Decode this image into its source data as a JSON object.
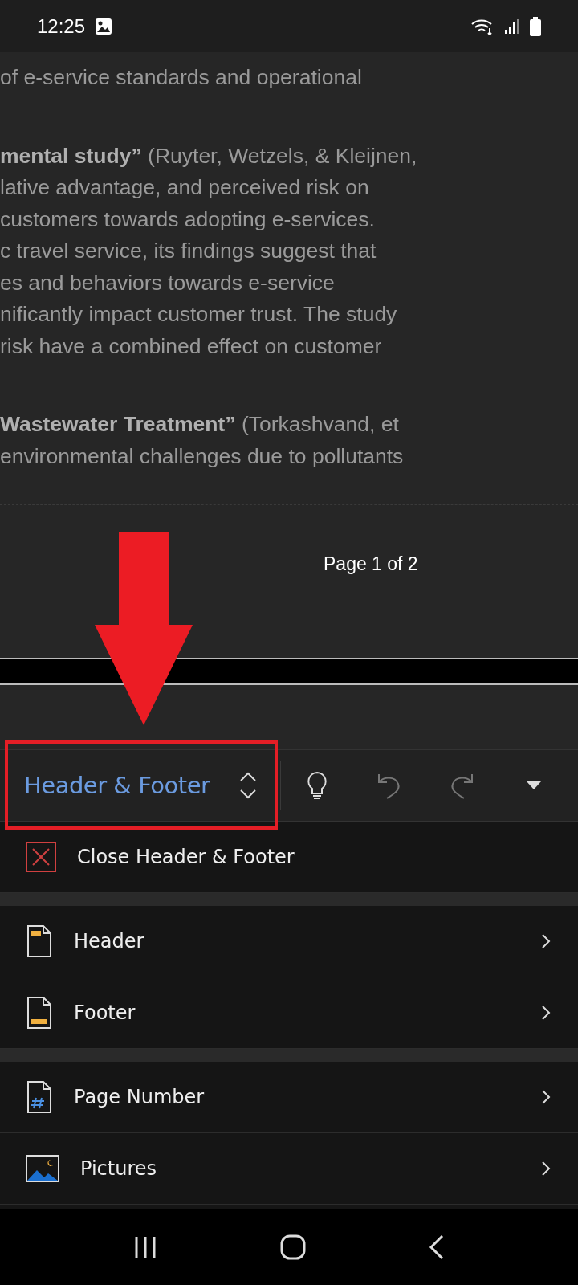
{
  "status_bar": {
    "time": "12:25"
  },
  "document": {
    "paragraphs": [
      {
        "lines": [
          "of e-service standards and operational"
        ]
      },
      {
        "lines": [
          "**mental study”** (Ruyter, Wetzels, & Kleijnen,",
          "lative advantage, and perceived risk on",
          "customers towards adopting e-services.",
          "c travel service, its findings suggest that",
          "es and behaviors towards e-service",
          "nificantly impact customer trust. The study",
          "risk have a combined effect on customer"
        ]
      },
      {
        "lines": [
          "**Wastewater Treatment”** (Torkashvand, et",
          "environmental challenges due to pollutants"
        ]
      }
    ],
    "footer_text": "Page 1 of 2"
  },
  "toolbar": {
    "title": "Header & Footer",
    "actions": [
      {
        "kind": "bulb",
        "disabled": false
      },
      {
        "kind": "undo",
        "disabled": true
      },
      {
        "kind": "redo",
        "disabled": true
      },
      {
        "kind": "more",
        "disabled": false
      }
    ]
  },
  "menu": {
    "close_label": "Close Header & Footer",
    "groups": [
      [
        {
          "kind": "header",
          "label": "Header"
        },
        {
          "kind": "footer",
          "label": "Footer"
        }
      ],
      [
        {
          "kind": "page-number",
          "label": "Page Number"
        },
        {
          "kind": "pictures",
          "label": "Pictures"
        }
      ]
    ]
  }
}
